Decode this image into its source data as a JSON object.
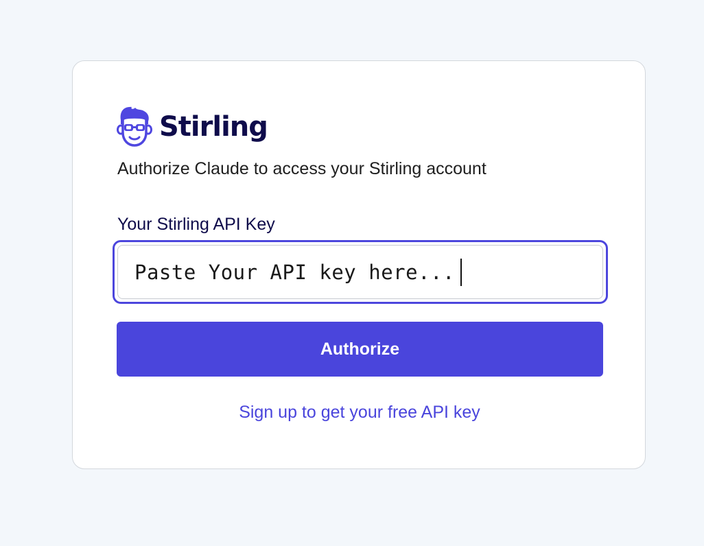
{
  "brand": {
    "name": "Stirling",
    "logo_icon": "stirling-mascot-icon",
    "accent_color": "#4a45dc",
    "text_color": "#0f0c4b"
  },
  "auth": {
    "subtitle": "Authorize Claude to access your Stirling account",
    "api_key_label": "Your Stirling API Key",
    "api_key_placeholder": "Paste Your API key here...",
    "api_key_value": "",
    "authorize_label": "Authorize",
    "signup_label": "Sign up to get your free API key"
  }
}
